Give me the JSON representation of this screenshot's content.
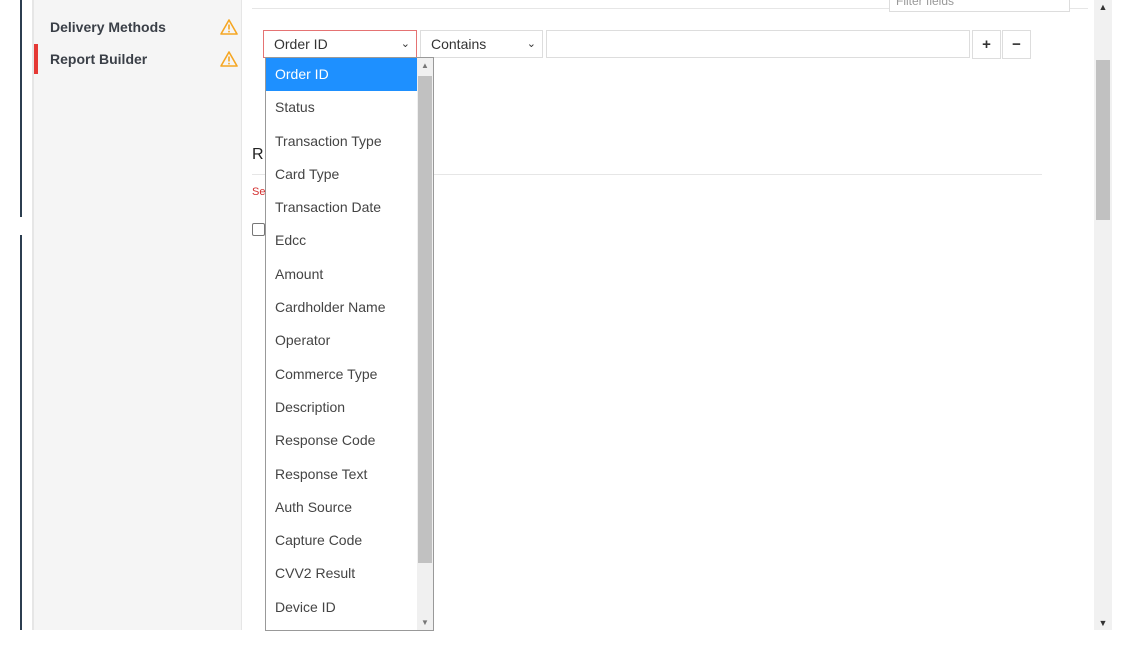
{
  "sidebar": {
    "items": [
      {
        "label": "Delivery Methods",
        "icon": "warning-icon",
        "active": false
      },
      {
        "label": "Report Builder",
        "icon": "warning-icon",
        "active": true
      }
    ]
  },
  "filter": {
    "placeholder": "Filter fields"
  },
  "criteria": {
    "field_value": "Order ID",
    "operator_value": "Contains",
    "value": "",
    "add_label": "+",
    "remove_label": "−"
  },
  "section": {
    "title": "R",
    "red_text": "Se"
  },
  "dropdown": {
    "selected": "Order ID",
    "options": [
      "Order ID",
      "Status",
      "Transaction Type",
      "Card Type",
      "Transaction Date",
      "Edcc",
      "Amount",
      "Cardholder Name",
      "Operator",
      "Commerce Type",
      "Description",
      "Response Code",
      "Response Text",
      "Auth Source",
      "Capture Code",
      "CVV2 Result",
      "Device ID"
    ]
  },
  "colors": {
    "accent": "#1e90ff",
    "active_marker": "#e53935",
    "warning": "#f5a623"
  }
}
